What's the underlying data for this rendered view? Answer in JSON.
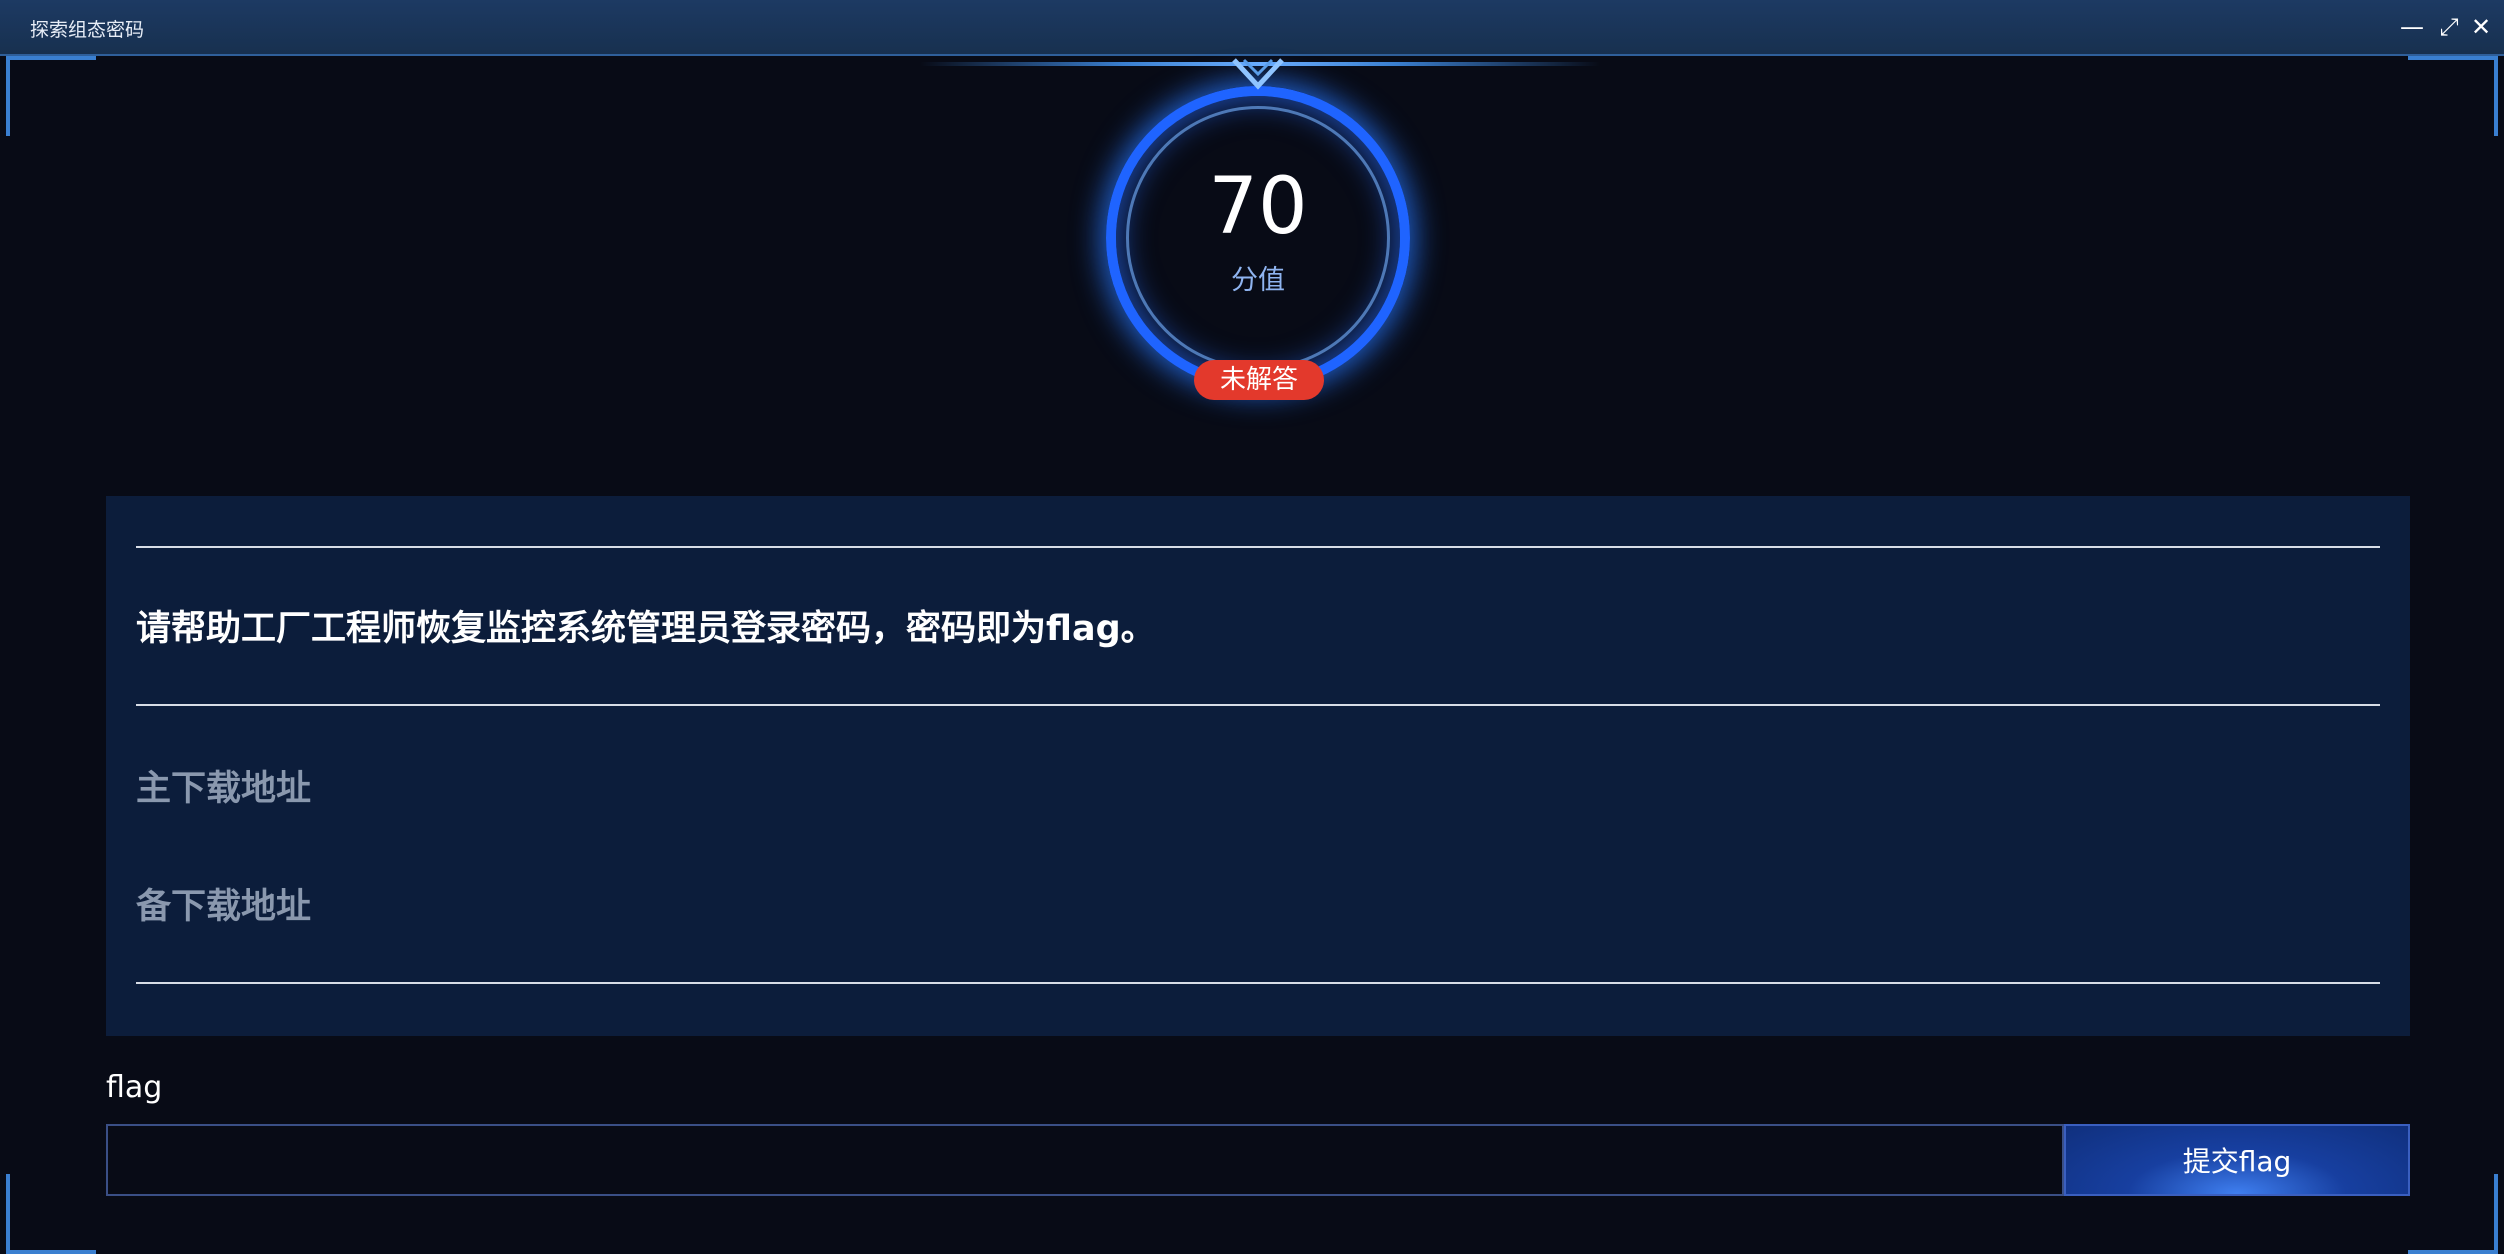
{
  "window": {
    "title": "探索组态密码",
    "minimize_symbol": "—",
    "maximize_symbol": "⤢",
    "close_symbol": "✕"
  },
  "score": {
    "value": "70",
    "label": "分值",
    "status": "未解答"
  },
  "challenge": {
    "description": "请帮助工厂工程师恢复监控系统管理员登录密码，密码即为flag。",
    "primary_download": "主下载地址",
    "backup_download": "备下载地址"
  },
  "flag_form": {
    "label": "flag",
    "input_value": "",
    "placeholder": "",
    "submit_label": "提交flag"
  },
  "colors": {
    "background": "#080b16",
    "panel": "#0c1d3b",
    "accent": "#1f64ff",
    "status_unanswered": "#e3392c"
  }
}
